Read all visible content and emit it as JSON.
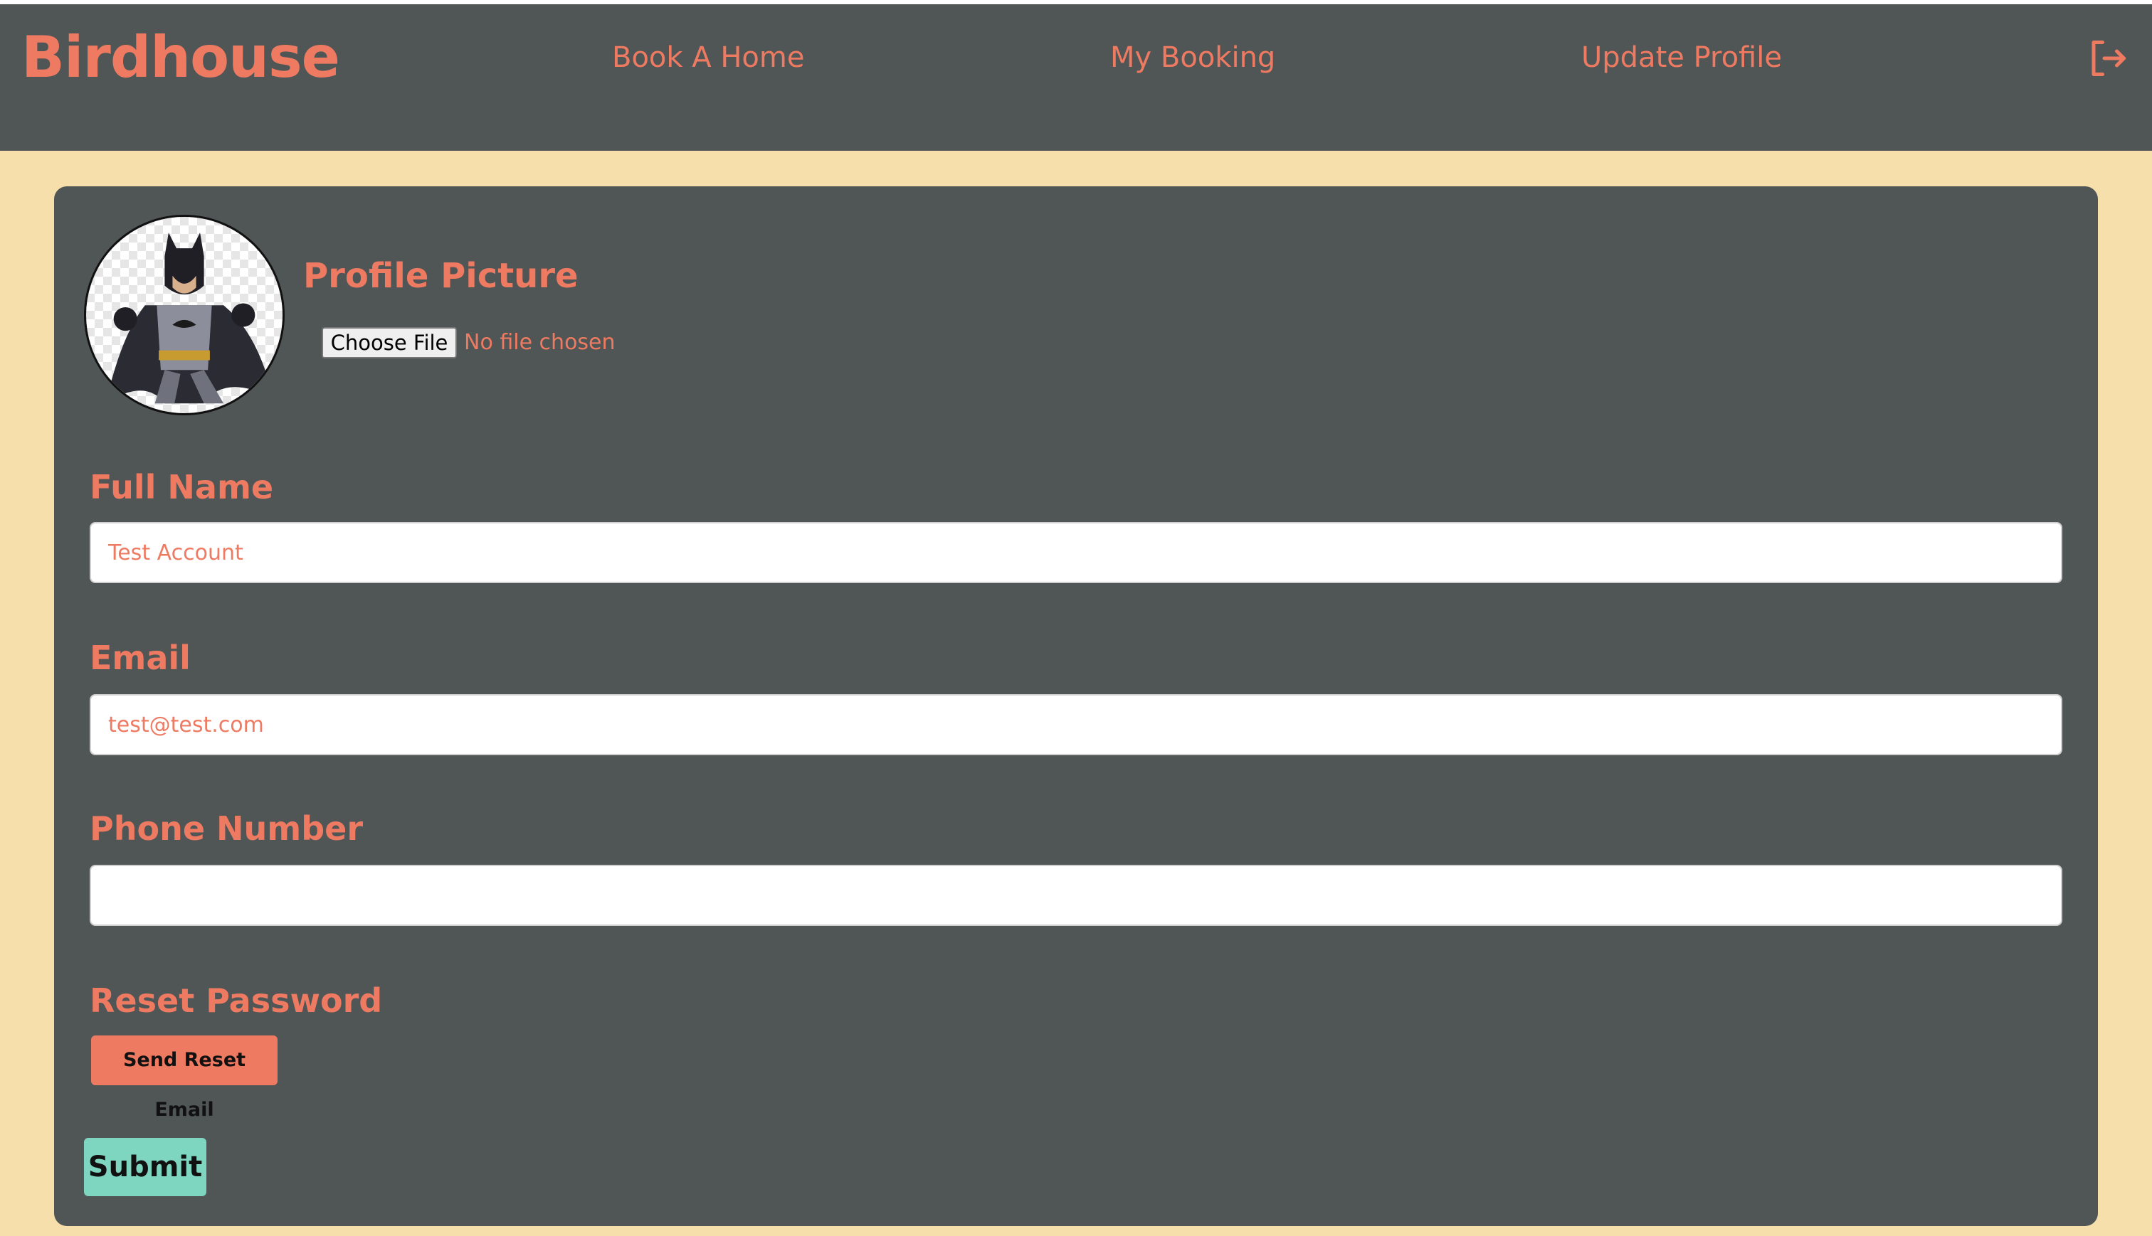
{
  "header": {
    "brand": "Birdhouse",
    "nav": [
      {
        "label": "Book A Home"
      },
      {
        "label": "My Booking"
      },
      {
        "label": "Update Profile"
      }
    ],
    "logout_icon": "logout-icon"
  },
  "profile": {
    "picture_title": "Profile Picture",
    "choose_file_label": "Choose File",
    "file_status": "No file chosen",
    "avatar_icon": "avatar-image"
  },
  "form": {
    "full_name": {
      "label": "Full Name",
      "value": "Test Account"
    },
    "email": {
      "label": "Email",
      "value": "test@test.com"
    },
    "phone": {
      "label": "Phone Number",
      "value": ""
    },
    "reset": {
      "label": "Reset Password",
      "button": "Send Reset Email"
    },
    "submit": "Submit"
  },
  "colors": {
    "accent": "#ef7a62",
    "panel": "#505556",
    "background": "#f6dfab",
    "submit": "#7ed5c0"
  }
}
